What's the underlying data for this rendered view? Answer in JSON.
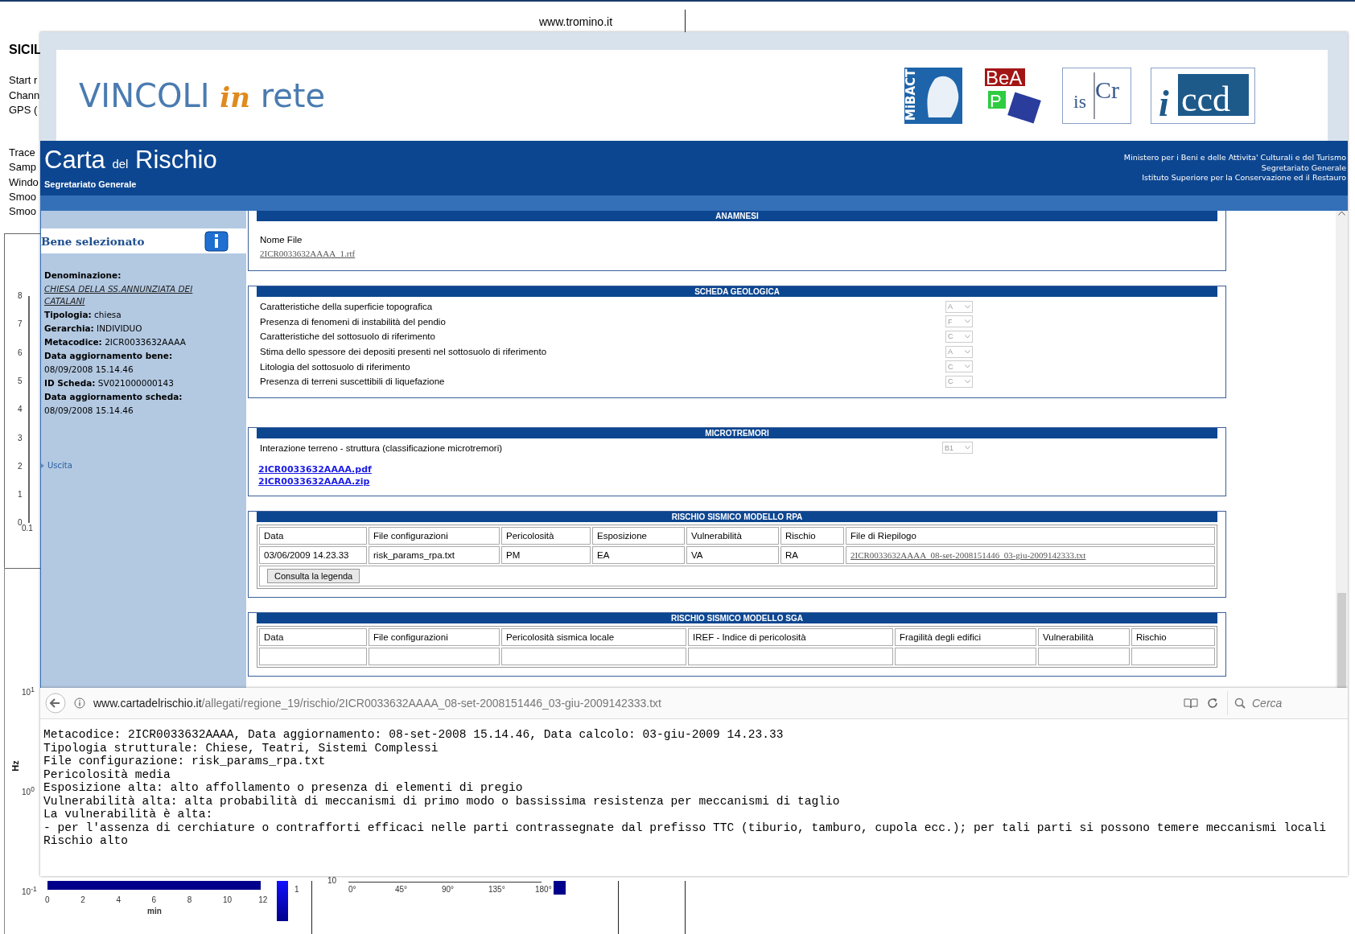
{
  "background_document": {
    "site_url": "www.tromino.it",
    "heading": "SICIL",
    "info_lines": [
      "Start r",
      "Chann",
      "GPS ("
    ],
    "trace_lines": [
      "Trace",
      "Samp",
      "Windo",
      "Smoo",
      "Smoo"
    ],
    "chart_y_ticks": [
      "8",
      "7",
      "6",
      "5",
      "4",
      "3",
      "2",
      "1",
      "0"
    ],
    "chart_x_tick": "0.1",
    "spectrum_axis": {
      "top": "10$^{1}$",
      "unit": "Hz",
      "middle": "10$^{0}$",
      "bottom": "10$^{-1}$"
    },
    "time_axis": {
      "ticks": [
        "0",
        "2",
        "4",
        "6",
        "8",
        "10",
        "12"
      ],
      "title": "min"
    },
    "colorbar_label": "1",
    "polar_axis": {
      "cut_label": "10",
      "ticks": [
        "0°",
        "45°",
        "90°",
        "135°",
        "180°"
      ]
    }
  },
  "main_window": {
    "banner": {
      "brand": {
        "first": "VINCOLI",
        "middle": "in",
        "last": "rete"
      },
      "logos": [
        {
          "kind": "mibact",
          "text": "MiBACT"
        },
        {
          "kind": "beap",
          "text": "BeA",
          "text2": "P"
        },
        {
          "kind": "iscr",
          "text": "is",
          "text2": "Cr"
        },
        {
          "kind": "iccd",
          "text": "i",
          "text2": "ccd"
        }
      ]
    },
    "header": {
      "title": {
        "first": "Carta",
        "middle": "del",
        "last": "Rischio"
      },
      "subtitle": "Segretariato Generale",
      "institutions": [
        "Ministero per i Beni e delle Attivita' Culturali e del Turismo",
        "Segretariato Generale",
        "Istituto Superiore per la Conservazione ed il Restauro"
      ]
    },
    "sidebar": {
      "title": "Bene selezionato",
      "fields": [
        {
          "label": "Denominazione:",
          "value": "CHIESA DELLA SS.ANNUNZIATA DEI CATALANI",
          "kind": "link"
        },
        {
          "label": "Tipologia:",
          "value": "chiesa",
          "kind": "inline"
        },
        {
          "label": "Gerarchia:",
          "value": "INDIVIDUO",
          "kind": "inline"
        },
        {
          "label": "Metacodice:",
          "value": "2ICR0033632AAAA",
          "kind": "inline"
        },
        {
          "label": "Data aggiornamento bene:",
          "value": "08/09/2008 15.14.46",
          "kind": "block"
        },
        {
          "label": "ID Scheda:",
          "value": "SV021000000143",
          "kind": "inline"
        },
        {
          "label": "Data aggiornamento scheda:",
          "value": "08/09/2008 15.14.46",
          "kind": "block"
        }
      ],
      "exit_link": "Uscita"
    },
    "anamnesi": {
      "title": "ANAMNESI",
      "label": "Nome File",
      "file": "2ICR0033632AAAA_1.rtf"
    },
    "scheda_geologica": {
      "title": "SCHEDA GEOLOGICA",
      "rows": [
        {
          "label": "Caratteristiche della superficie topografica",
          "value": "A",
          "disabled": true
        },
        {
          "label": "Presenza di fenomeni di instabilità del pendio",
          "value": "F",
          "disabled": true
        },
        {
          "label": "Caratteristiche del sottosuolo di riferimento",
          "value": "C",
          "disabled": true
        },
        {
          "label": "Stima dello spessore dei depositi presenti nel sottosuolo di riferimento",
          "value": "A",
          "disabled": true
        },
        {
          "label": "Litologia del sottosuolo di riferimento",
          "value": "C",
          "disabled": true
        },
        {
          "label": "Presenza di terreni suscettibili di liquefazione",
          "value": "C",
          "disabled": true
        }
      ]
    },
    "microtremori": {
      "title": "MICROTREMORI",
      "rows": [
        {
          "label": "Interazione terreno - struttura (classificazione microtremori)",
          "value": "B1",
          "disabled": true
        }
      ],
      "links": [
        "2ICR0033632AAAA.pdf",
        "2ICR0033632AAAA.zip"
      ]
    },
    "rischio_rpa": {
      "title": "RISCHIO SISMICO MODELLO RPA",
      "columns": [
        "Data",
        "File configurazioni",
        "Pericolosità",
        "Esposizione",
        "Vulnerabilità",
        "Rischio",
        "File di Riepilogo"
      ],
      "rows": [
        [
          "03/06/2009 14.23.33",
          "risk_params_rpa.txt",
          "PM",
          "EA",
          "VA",
          "RA",
          "2ICR0033632AAAA_08-set-2008151446_03-giu-2009142333.txt"
        ]
      ],
      "button": "Consulta la legenda"
    },
    "rischio_sga": {
      "title": "RISCHIO SISMICO MODELLO SGA",
      "columns": [
        "Data",
        "File configurazioni",
        "Pericolosità sismica locale",
        "IREF - Indice di pericolosità",
        "Fragilità degli edifici",
        "Vulnerabilità",
        "Rischio"
      ]
    }
  },
  "text_window": {
    "url": {
      "host": "www.cartadelrischio.it",
      "path": "/allegati/regione_19/rischio/2ICR0033632AAAA_08-set-2008151446_03-giu-2009142333.txt"
    },
    "search": {
      "placeholder": "Cerca"
    },
    "lines": [
      "Metacodice: 2ICR0033632AAAA, Data aggiornamento: 08-set-2008 15.14.46, Data calcolo: 03-giu-2009 14.23.33",
      "Tipologia strutturale: Chiese, Teatri, Sistemi Complessi",
      "File configurazione: risk_params_rpa.txt",
      "Pericolosità media",
      "Esposizione alta: alto affollamento o presenza di elementi di pregio",
      "Vulnerabilità alta: alta probabilità di meccanismi di primo modo o bassissima resistenza per meccanismi di taglio",
      "La vulnerabilità è alta:",
      "- per l'assenza di cerchiature o contrafforti efficaci nelle parti contrassegnate dal prefisso TTC (tiburio, tamburo, cupola ecc.); per tali parti si possono temere meccanismi locali",
      "Rischio alto"
    ]
  }
}
